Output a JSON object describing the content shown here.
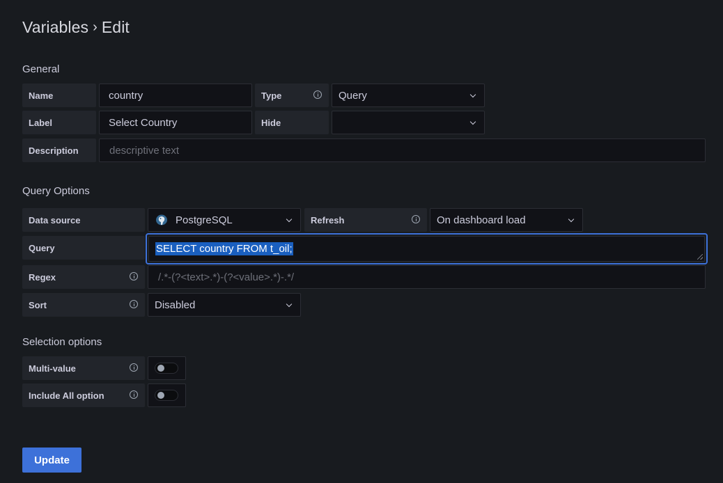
{
  "header": {
    "breadcrumb_root": "Variables",
    "separator": "›",
    "current": "Edit"
  },
  "general": {
    "section_title": "General",
    "name_label": "Name",
    "name_value": "country",
    "type_label": "Type",
    "type_value": "Query",
    "label_label": "Label",
    "label_value": "Select Country",
    "hide_label": "Hide",
    "hide_value": "",
    "description_label": "Description",
    "description_placeholder": "descriptive text"
  },
  "query_options": {
    "section_title": "Query Options",
    "datasource_label": "Data source",
    "datasource_value": "PostgreSQL",
    "datasource_icon": "postgresql-icon",
    "refresh_label": "Refresh",
    "refresh_value": "On dashboard load",
    "query_label": "Query",
    "query_value": "SELECT country FROM t_oil;",
    "regex_label": "Regex",
    "regex_placeholder": "/.*-(?<text>.*)-(?<value>.*)-.*/",
    "sort_label": "Sort",
    "sort_value": "Disabled"
  },
  "selection_options": {
    "section_title": "Selection options",
    "multi_value_label": "Multi-value",
    "multi_value_enabled": false,
    "include_all_label": "Include All option",
    "include_all_enabled": false
  },
  "actions": {
    "update_label": "Update"
  },
  "colors": {
    "background": "#181b1f",
    "label_bg": "#22252b",
    "input_bg": "#111217",
    "accent": "#3d71d9",
    "selection": "#1a5fbf"
  }
}
